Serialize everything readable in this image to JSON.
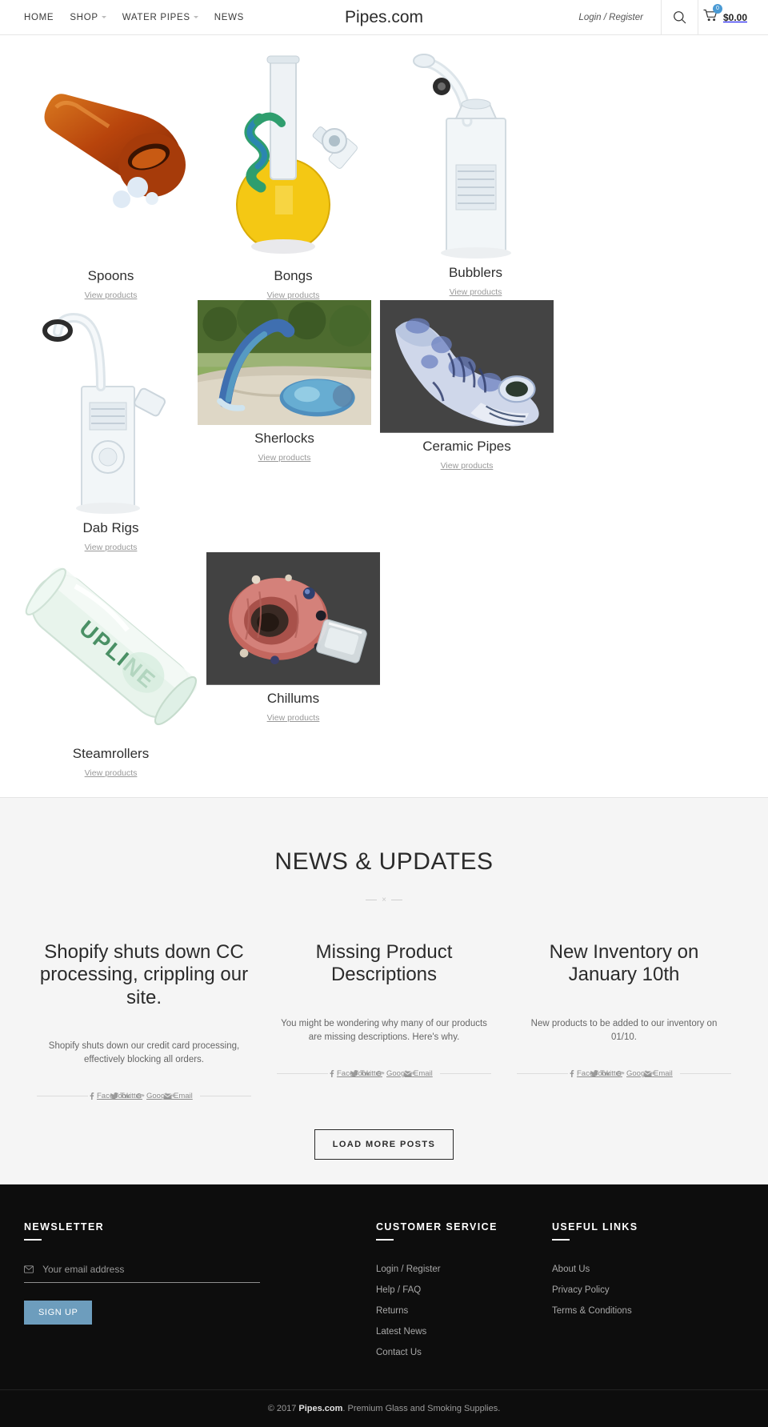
{
  "header": {
    "brand": "Pipes.com",
    "nav": [
      {
        "label": "HOME",
        "caret": false
      },
      {
        "label": "SHOP",
        "caret": true
      },
      {
        "label": "WATER PIPES",
        "caret": true
      },
      {
        "label": "NEWS",
        "caret": false
      }
    ],
    "login_label": "Login / Register",
    "search_icon": "search-icon",
    "cart_icon": "cart-icon",
    "cart_count": "0",
    "cart_total": "$0.00",
    "accent_color": "#4a9ad4"
  },
  "collections": {
    "view_label": "View products",
    "items": [
      {
        "title": "Spoons",
        "kind": "spoon"
      },
      {
        "title": "Bongs",
        "kind": "bong"
      },
      {
        "title": "Bubblers",
        "kind": "bubbler"
      },
      {
        "title": "Dab Rigs",
        "kind": "dabrig"
      },
      {
        "title": "Sherlocks",
        "kind": "sherlock"
      },
      {
        "title": "Ceramic Pipes",
        "kind": "ceramic"
      },
      {
        "title": "Steamrollers",
        "kind": "steamroller"
      },
      {
        "title": "Chillums",
        "kind": "chillum"
      }
    ]
  },
  "news": {
    "heading": "NEWS & UPDATES",
    "divider_glyph": "×",
    "share_labels": [
      "Facebook",
      "Twitter",
      "Google+",
      "Email"
    ],
    "posts": [
      {
        "title": "Shopify shuts down CC processing, crippling our site.",
        "excerpt": "Shopify shuts down our credit card processing, effectively blocking all orders."
      },
      {
        "title": "Missing Product Descriptions",
        "excerpt": "You might be wondering why many of our products are missing descriptions. Here's why."
      },
      {
        "title": "New Inventory on January 10th",
        "excerpt": "New products to be added to our inventory on 01/10."
      }
    ],
    "load_more_label": "LOAD MORE POSTS"
  },
  "footer": {
    "newsletter": {
      "heading": "NEWSLETTER",
      "email_placeholder": "Your email address",
      "email_value": "",
      "signup_label": "SIGN UP",
      "signup_color": "#6d9dbd",
      "mail_icon": "mail-icon"
    },
    "customer_service": {
      "heading": "CUSTOMER SERVICE",
      "links": [
        "Login / Register",
        "Help / FAQ",
        "Returns",
        "Latest News",
        "Contact Us"
      ]
    },
    "useful_links": {
      "heading": "USEFUL LINKS",
      "links": [
        "About Us",
        "Privacy Policy",
        "Terms & Conditions"
      ]
    },
    "copyright_prefix": "© 2017 ",
    "copyright_brand": "Pipes.com",
    "copyright_suffix": ". Premium Glass and Smoking Supplies."
  }
}
